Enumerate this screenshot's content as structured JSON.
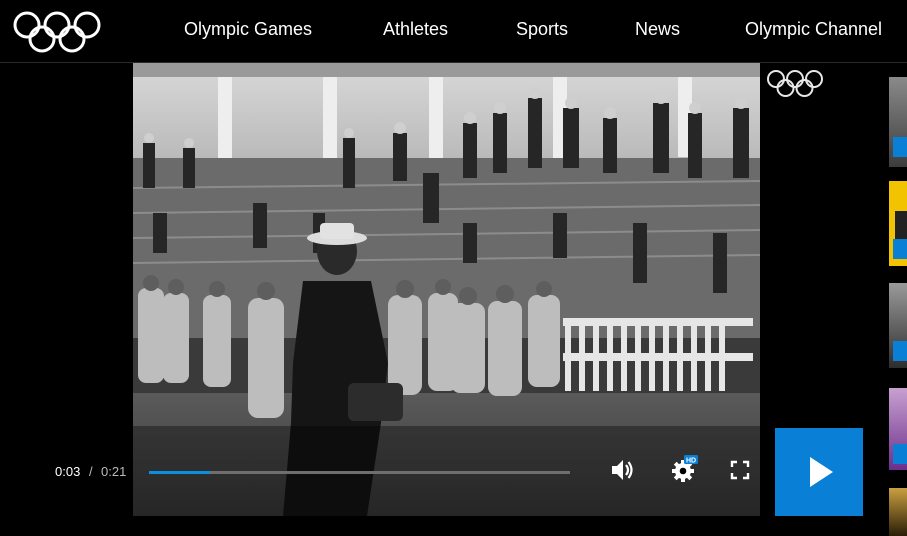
{
  "nav": {
    "items": [
      "Olympic Games",
      "Athletes",
      "Sports",
      "News",
      "Olympic Channel"
    ]
  },
  "player": {
    "current_time": "0:03",
    "separator": "/",
    "duration": "0:21",
    "progress": 0.145,
    "hd_badge": "HD"
  },
  "colors": {
    "accent": "#0a7fd6",
    "progress_fill": "#0b8fe0"
  },
  "icons": [
    "olympic-rings-icon",
    "volume-icon",
    "gear-icon",
    "fullscreen-icon",
    "play-icon"
  ]
}
